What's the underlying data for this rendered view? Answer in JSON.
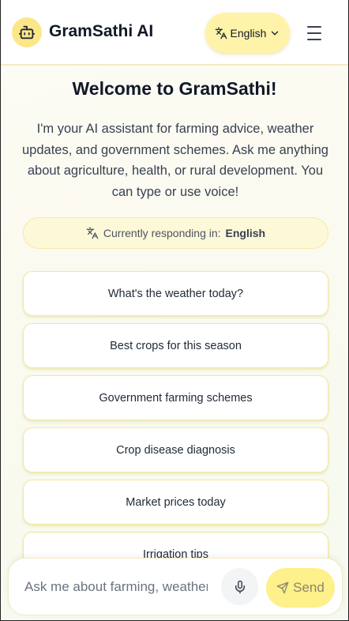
{
  "header": {
    "app_title": "GramSathi AI",
    "language_button": "English",
    "logo_icon": "robot-icon",
    "menu_icon": "hamburger-menu-icon"
  },
  "welcome": {
    "title": "Welcome to GramSathi!",
    "description": "I'm your AI assistant for farming advice, weather updates, and government schemes. Ask me anything about agriculture, health, or rural development. You can type or use voice!"
  },
  "language_status": {
    "prefix": "Currently responding in:",
    "language": "English"
  },
  "suggestions": [
    "What's the weather today?",
    "Best crops for this season",
    "Government farming schemes",
    "Crop disease diagnosis",
    "Market prices today",
    "Irrigation tips"
  ],
  "input": {
    "placeholder": "Ask me about farming, weather, schemes...",
    "send_label": "Send"
  },
  "colors": {
    "accent": "#fde68a",
    "accent_light": "#fef3a8",
    "border": "#f4e79a",
    "text": "#1f2937"
  }
}
